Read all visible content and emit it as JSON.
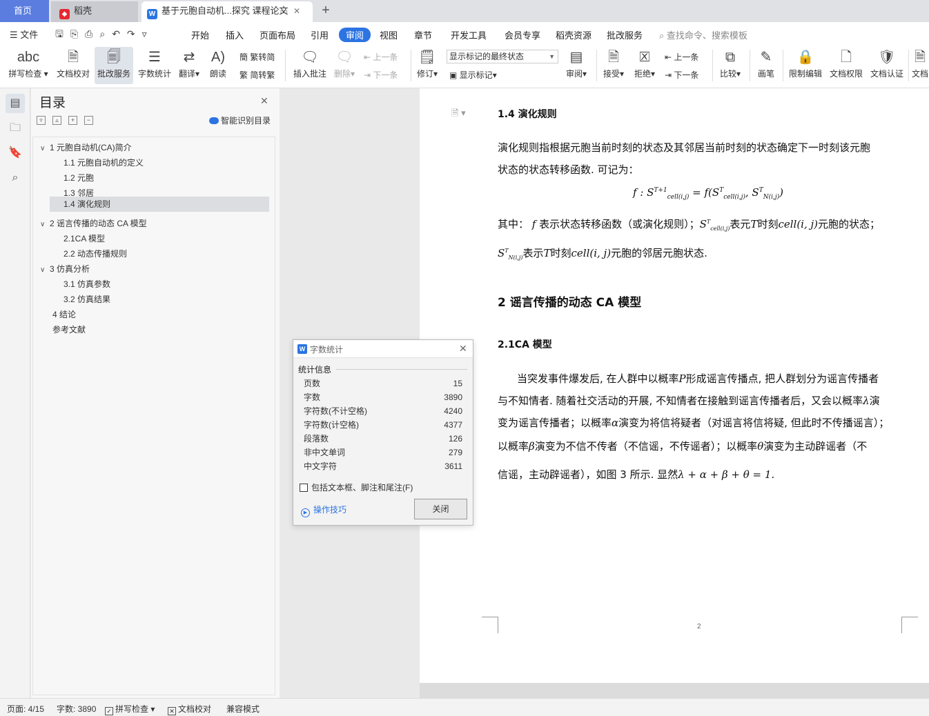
{
  "tabs": {
    "home": "首页",
    "daoke": "稻壳",
    "document": "基于元胞自动机...探究 课程论文",
    "add": "+"
  },
  "menubar": {
    "file": "文件",
    "items": [
      "开始",
      "插入",
      "页面布局",
      "引用",
      "审阅",
      "视图",
      "章节",
      "开发工具",
      "会员专享",
      "稻壳资源",
      "批改服务"
    ],
    "active": "审阅",
    "search_placeholder": "查找命令、搜索模板"
  },
  "ribbon": {
    "spell_check": "拼写检查",
    "doc_proof": "文档校对",
    "review_service": "批改服务",
    "word_count": "字数统计",
    "translate": "翻译",
    "read_aloud": "朗读",
    "trad_to_simp": "繁转简",
    "simp_to_trad": "简转繁",
    "insert_comment": "插入批注",
    "delete": "删除",
    "prev_comment": "上一条",
    "next_comment": "下一条",
    "track_changes": "修订",
    "markup_state": "显示标记的最终状态",
    "show_markup": "显示标记",
    "review_pane": "审阅",
    "accept": "接受",
    "reject": "拒绝",
    "prev_change": "上一条",
    "next_change": "下一条",
    "compare": "比较",
    "pen": "画笔",
    "restrict_edit": "限制编辑",
    "doc_rights": "文档权限",
    "doc_certify": "文档认证",
    "doc_more": "文档"
  },
  "toc": {
    "title": "目录",
    "smart_label": "智能识别目录",
    "items": [
      {
        "label": "1 元胞自动机(CA)简介",
        "level": 1,
        "expanded": true
      },
      {
        "label": "1.1 元胞自动机的定义",
        "level": 2
      },
      {
        "label": "1.2 元胞",
        "level": 2
      },
      {
        "label": "1.3 邻居",
        "level": 2
      },
      {
        "label": "1.4 演化规则",
        "level": 2,
        "selected": true
      },
      {
        "label": "2 谣言传播的动态 CA 模型",
        "level": 1,
        "expanded": true
      },
      {
        "label": "2.1CA 模型",
        "level": 2
      },
      {
        "label": "2.2 动态传播规则",
        "level": 2
      },
      {
        "label": "3 仿真分析",
        "level": 1,
        "expanded": true
      },
      {
        "label": "3.1 仿真参数",
        "level": 2
      },
      {
        "label": "3.2 仿真结果",
        "level": 2
      },
      {
        "label": "4 结论",
        "level": 1
      },
      {
        "label": "参考文献",
        "level": 1
      }
    ]
  },
  "document": {
    "h_1_4": "1.4 演化规则",
    "p1_line1": "演化规则指根据元胞当前时刻的状态及其邻居当前时刻的状态确定下一时刻该元胞",
    "p1_line2": "状态的状态转移函数. 可记为：",
    "formula": "f : S^{T+1}_{cell(i,j)} = f(S^{T}_{cell(i,j)}, S^{T}_{N(i,j)})",
    "p2_a": "其中：",
    "p2_b": "表示状态转移函数（或演化规则）；",
    "p2_c": "表元",
    "p2_d": "时刻",
    "p2_e": "元胞的状态；",
    "p3_a": "表示",
    "p3_b": "时刻",
    "p3_c": "元胞的邻居元胞状态.",
    "h_2": "2 谣言传播的动态 CA 模型",
    "h_2_1": "2.1CA 模型",
    "p4_line1": "当突发事件爆发后, 在人群中以概率",
    "p4_line1b": "形成谣言传播点, 把人群划分为谣言传播者",
    "p4_line2": "与不知情者. 随着社交活动的开展, 不知情者在接触到谣言传播者后，又会以概率",
    "p4_line2b": "演",
    "p4_line3": "变为谣言传播者；以概率",
    "p4_line3b": "演变为将信将疑者（对谣言将信将疑, 但此时不传播谣言）；",
    "p4_line4": "以概率",
    "p4_line4b": "演变为不信不传者（不信谣，不传谣者）；以概率",
    "p4_line4c": "演变为主动辟谣者（不",
    "p4_line5": "信谣，主动辟谣者），如图 3 所示. 显然",
    "p4_line5b": "λ + α + β + θ = 1.",
    "page_number": "2"
  },
  "dialog": {
    "title": "字数统计",
    "section": "统计信息",
    "rows": [
      {
        "label": "页数",
        "value": "15"
      },
      {
        "label": "字数",
        "value": "3890"
      },
      {
        "label": "字符数(不计空格)",
        "value": "4240"
      },
      {
        "label": "字符数(计空格)",
        "value": "4377"
      },
      {
        "label": "段落数",
        "value": "126"
      },
      {
        "label": "非中文单词",
        "value": "279"
      },
      {
        "label": "中文字符",
        "value": "3611"
      }
    ],
    "checkbox_label": "包括文本框、脚注和尾注(F)",
    "checkbox_checked": false,
    "tips": "操作技巧",
    "close_button": "关闭"
  },
  "statusbar": {
    "page": "页面: 4/15",
    "words": "字数: 3890",
    "spell_check": "拼写检查",
    "doc_proof": "文档校对",
    "compat": "兼容模式"
  },
  "colors": {
    "accent": "#2b74e2",
    "home_tab": "#5b7de0",
    "selected_toc": "#dcdde0"
  }
}
